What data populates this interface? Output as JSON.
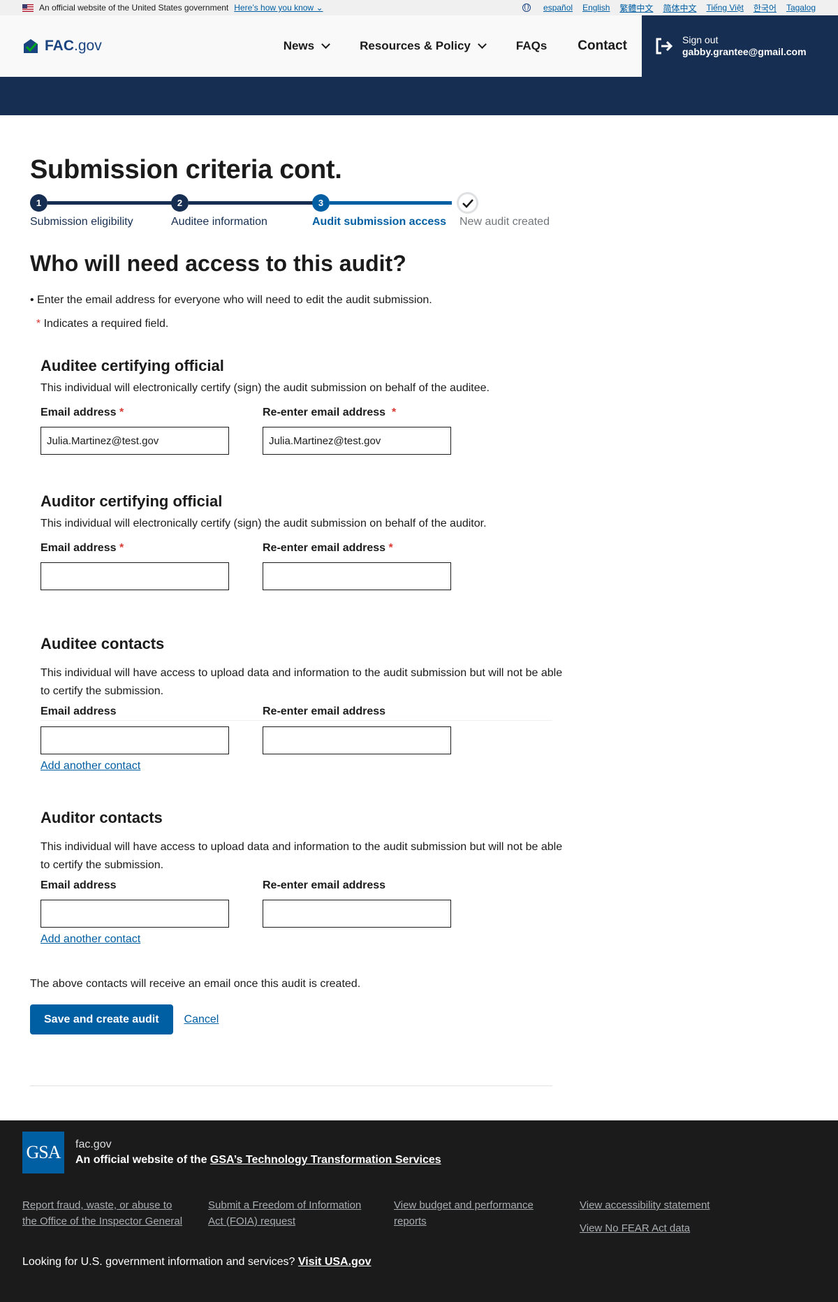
{
  "banner": {
    "official_text": "An official website of the United States government",
    "how_link": "Here’s how you know",
    "languages": [
      "español",
      "English",
      "繁體中文",
      "简体中文",
      "Tiếng Việt",
      "한국어",
      "Tagalog"
    ]
  },
  "header": {
    "logo_fac": "FAC",
    "logo_gov": ".gov",
    "nav": {
      "news": "News",
      "resources": "Resources & Policy",
      "faqs": "FAQs",
      "contact": "Contact"
    },
    "signout_label": "Sign out",
    "user_email": "gabby.grantee@gmail.com"
  },
  "page": {
    "title": "Submission criteria cont.",
    "steps": [
      {
        "number": "1",
        "label": "Submission eligibility"
      },
      {
        "number": "2",
        "label": "Auditee information"
      },
      {
        "number": "3",
        "label": "Audit submission access"
      },
      {
        "number": "",
        "label": "New audit created"
      }
    ],
    "question": "Who will need access to this audit?",
    "bullet": "Enter the email address for everyone who will need to edit the audit submission.",
    "required_note": "Indicates a required field.",
    "required_mark": "*"
  },
  "sections": {
    "auditee_official": {
      "title": "Auditee certifying official",
      "description": "This individual will electronically certify (sign) the audit submission on behalf of the auditee.",
      "email_label": "Email address",
      "reenter_label": "Re-enter email address",
      "email_value": "Julia.Martinez@test.gov",
      "reenter_value": "Julia.Martinez@test.gov"
    },
    "auditor_official": {
      "title": "Auditor certifying official",
      "description": "This individual will electronically certify (sign) the audit submission on behalf of the auditor.",
      "email_label": "Email address",
      "reenter_label": "Re-enter email address",
      "email_value": "",
      "reenter_value": ""
    },
    "auditee_contacts": {
      "title": "Auditee contacts",
      "description": "This individual will have access to upload data and information to the audit submission but will not be able to certify the submission.",
      "email_label": "Email address",
      "reenter_label": "Re-enter email address",
      "add_link": "Add another contact"
    },
    "auditor_contacts": {
      "title": "Auditor contacts",
      "description": "This individual will have access to upload data and information to the audit submission but will not be able to certify the submission.",
      "email_label": "Email address",
      "reenter_label": "Re-enter email address",
      "add_link": "Add another contact"
    }
  },
  "actions": {
    "note": "The above contacts will receive an email once this audit is created.",
    "save": "Save and create audit",
    "cancel": "Cancel"
  },
  "footer": {
    "logo_text": "GSA",
    "domain": "fac.gov",
    "official_prefix": "An official website of the ",
    "official_link": "GSA’s Technology Transformation Services",
    "links": {
      "fraud": "Report fraud, waste, or abuse to the Office of the Inspector General",
      "foia": "Submit a Freedom of Information Act (FOIA) request",
      "budget": "View budget and performance reports",
      "accessibility": "View accessibility statement",
      "nofear": "View No FEAR Act data"
    },
    "bottom_prefix": "Looking for U.S. government information and services? ",
    "bottom_link": "Visit USA.gov"
  },
  "colors": {
    "primary": "#005ea2",
    "navy": "#162e51",
    "step_active": "#005ea2",
    "step_complete": "#162e51",
    "required": "#d83933",
    "footer_bg": "#1b1b1b"
  }
}
